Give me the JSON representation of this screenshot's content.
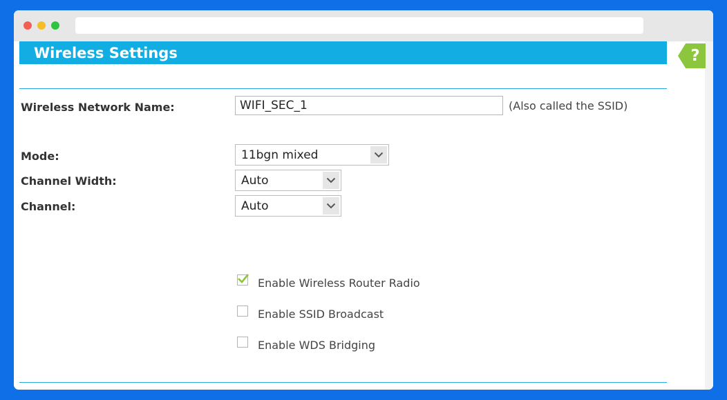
{
  "window": {
    "url": ""
  },
  "page": {
    "title": "Wireless Settings",
    "help_glyph": "?"
  },
  "form": {
    "ssid": {
      "label": "Wireless Network Name:",
      "value": "WIFI_SEC_1",
      "hint": "(Also called the SSID)"
    },
    "mode": {
      "label": "Mode:",
      "selected": "11bgn mixed"
    },
    "channel_width": {
      "label": "Channel Width:",
      "selected": "Auto"
    },
    "channel": {
      "label": "Channel:",
      "selected": "Auto"
    },
    "options": [
      {
        "label": "Enable Wireless Router Radio",
        "checked": true
      },
      {
        "label": "Enable SSID Broadcast",
        "checked": false
      },
      {
        "label": "Enable WDS Bridging",
        "checked": false
      }
    ]
  },
  "colors": {
    "background": "#0f6fe6",
    "header_bar": "#12aee3",
    "help_tab": "#8cc63f",
    "check_mark": "#8cc63f"
  },
  "icons": {
    "dropdown": "chevron-down-icon",
    "help": "help-icon",
    "check": "check-icon"
  }
}
